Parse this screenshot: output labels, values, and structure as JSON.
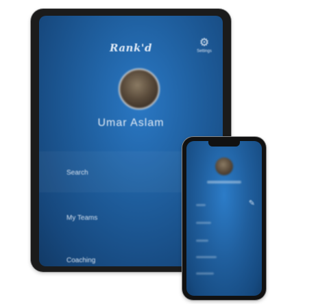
{
  "tablet": {
    "brand_logo": "Rank'd",
    "settings_label": "Settings",
    "user_name": "Umar Aslam",
    "menu": [
      {
        "label": "Search",
        "active": true
      },
      {
        "label": "My Teams",
        "active": false
      },
      {
        "label": "Coaching",
        "active": false
      }
    ]
  },
  "phone": {
    "menu_item_count": 4
  },
  "colors": {
    "screen_blue": "#1f5f9f",
    "screen_highlight": "#2a78c4",
    "device_frame": "#1b1b1b",
    "text_light": "#e6eef7"
  }
}
